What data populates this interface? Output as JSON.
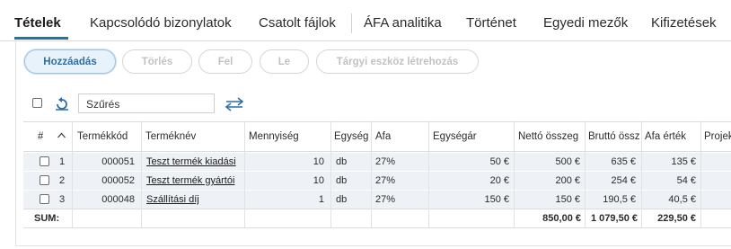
{
  "tabs": [
    {
      "label": "Tételek",
      "active": true
    },
    {
      "label": "Kapcsolódó bizonylatok"
    },
    {
      "label": "Csatolt fájlok"
    },
    {
      "label": "ÁFA analitika"
    },
    {
      "label": "Történet"
    },
    {
      "label": "Egyedi mezők"
    },
    {
      "label": "Kifizetések"
    }
  ],
  "toolbar": {
    "add": "Hozzáadás",
    "delete": "Törlés",
    "up": "Fel",
    "down": "Le",
    "asset": "Tárgyi eszköz létrehozás"
  },
  "filter": {
    "value": "Szűrés"
  },
  "table": {
    "headers": {
      "num": "#",
      "code": "Termékkód",
      "name": "Terméknév",
      "qty": "Mennyiség",
      "unit": "Egység",
      "vat": "Áfa",
      "unit_price": "Egységár",
      "net": "Nettó összeg",
      "gross": "Bruttó összeg",
      "vat_value": "Áfa érték",
      "project": "Projekt"
    },
    "rows": [
      {
        "num": "1",
        "code": "000051",
        "name": "Teszt termék kiadási",
        "qty": "10",
        "unit": "db",
        "vat": "27%",
        "unit_price": "50 €",
        "net": "500 €",
        "gross": "635 €",
        "vat_value": "135 €"
      },
      {
        "num": "2",
        "code": "000052",
        "name": "Teszt termék gyártói",
        "qty": "10",
        "unit": "db",
        "vat": "27%",
        "unit_price": "20 €",
        "net": "200 €",
        "gross": "254 €",
        "vat_value": "54 €"
      },
      {
        "num": "3",
        "code": "000048",
        "name": "Szállítási díj",
        "qty": "1",
        "unit": "db",
        "vat": "27%",
        "unit_price": "150 €",
        "net": "150 €",
        "gross": "190,5 €",
        "vat_value": "40,5 €"
      }
    ],
    "sum": {
      "label": "SUM:",
      "net": "850,00 €",
      "gross": "1 079,50 €",
      "vat_value": "229,50 €"
    }
  },
  "colors": {
    "accent": "#2f6ea3",
    "row_bg": "#eef1f5"
  }
}
